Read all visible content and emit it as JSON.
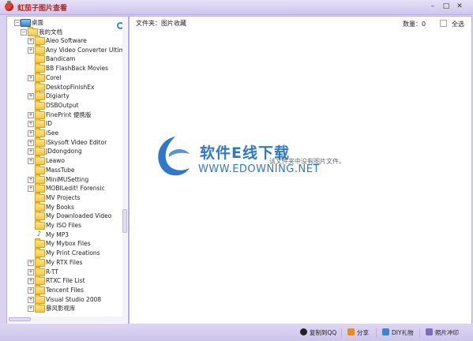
{
  "app": {
    "title": "虹茄子图片查看"
  },
  "window_buttons": {
    "minimize": "–",
    "maximize": "□",
    "close": "✕"
  },
  "sidebar": {
    "root": "桌面",
    "mydocs": "我的文档",
    "items": [
      {
        "label": "Aleo Software",
        "expandable": true
      },
      {
        "label": "Any Video Converter Ultim",
        "expandable": true
      },
      {
        "label": "Bandicam",
        "expandable": false
      },
      {
        "label": "BB FlashBack Movies",
        "expandable": false
      },
      {
        "label": "Corel",
        "expandable": true
      },
      {
        "label": "DesktopFinishEx",
        "expandable": false
      },
      {
        "label": "Digiarty",
        "expandable": true
      },
      {
        "label": "DSBOutput",
        "expandable": false
      },
      {
        "label": "FinePrint 便携版",
        "expandable": true
      },
      {
        "label": "ID",
        "expandable": true
      },
      {
        "label": "iSee",
        "expandable": true
      },
      {
        "label": "iSkysoft Video Editor",
        "expandable": true
      },
      {
        "label": "JDdongdong",
        "expandable": true
      },
      {
        "label": "Leawo",
        "expandable": true
      },
      {
        "label": "MassTube",
        "expandable": false
      },
      {
        "label": "MiniMUSetting",
        "expandable": true
      },
      {
        "label": "MOBILedit! Forensic",
        "expandable": true
      },
      {
        "label": "MV Projects",
        "expandable": false
      },
      {
        "label": "My Books",
        "expandable": false
      },
      {
        "label": "My Downloaded Video",
        "expandable": false
      },
      {
        "label": "My ISO Files",
        "expandable": false
      },
      {
        "label": "My MP3",
        "expandable": false,
        "icon": "music-note-icon"
      },
      {
        "label": "My Mybox Files",
        "expandable": false
      },
      {
        "label": "My Print Creations",
        "expandable": false
      },
      {
        "label": "My RTX Files",
        "expandable": true
      },
      {
        "label": "R-TT",
        "expandable": true
      },
      {
        "label": "RTXC File List",
        "expandable": true
      },
      {
        "label": "Tencent Files",
        "expandable": true
      },
      {
        "label": "Visual Studio 2008",
        "expandable": true
      },
      {
        "label": "暴风影视库",
        "expandable": true
      }
    ]
  },
  "main": {
    "folder_label": "文件夹：图片收藏",
    "count_label": "数量：0",
    "select_all": "全选",
    "empty_message": "该文件夹中没有图片文件。"
  },
  "watermark": {
    "brand": "软件E线下载",
    "url": "WWW.EDOWNING.NET"
  },
  "bottom": {
    "copy_qq": "复制到QQ",
    "share": "分享",
    "diy_gift": "DIY礼物",
    "photo_print": "照片冲印"
  },
  "colors": {
    "accent": "#2f78c9",
    "title_red": "#b8231c",
    "frame": "#d9d3ef"
  }
}
